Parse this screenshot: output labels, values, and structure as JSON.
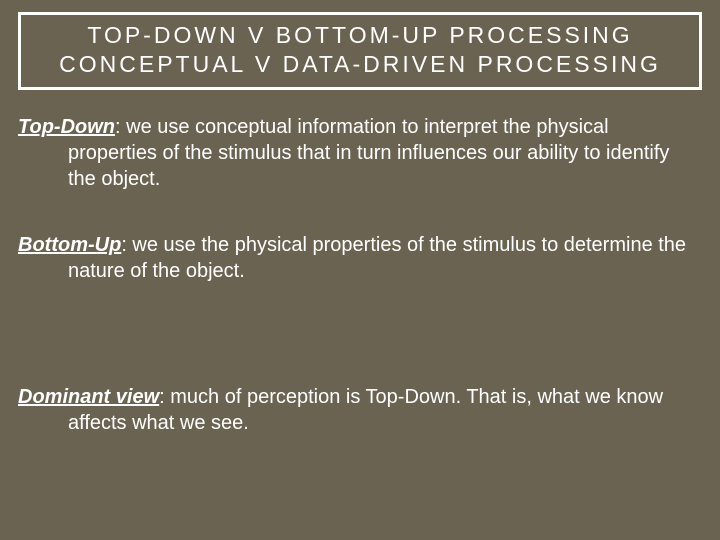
{
  "title": {
    "line1": "TOP-DOWN V BOTTOM-UP PROCESSING",
    "line2": "CONCEPTUAL V DATA-DRIVEN PROCESSING"
  },
  "entries": {
    "topdown": {
      "term": "Top-Down",
      "text": ": we use conceptual information to interpret the physical properties of the stimulus that in turn influences our ability to identify the object."
    },
    "bottomup": {
      "term": "Bottom-Up",
      "text": ": we use the physical properties of the stimulus to determine the nature of the object."
    },
    "dominant": {
      "term": "Dominant view",
      "text": ": much of perception is Top-Down.  That is, what we know affects what we see."
    }
  }
}
